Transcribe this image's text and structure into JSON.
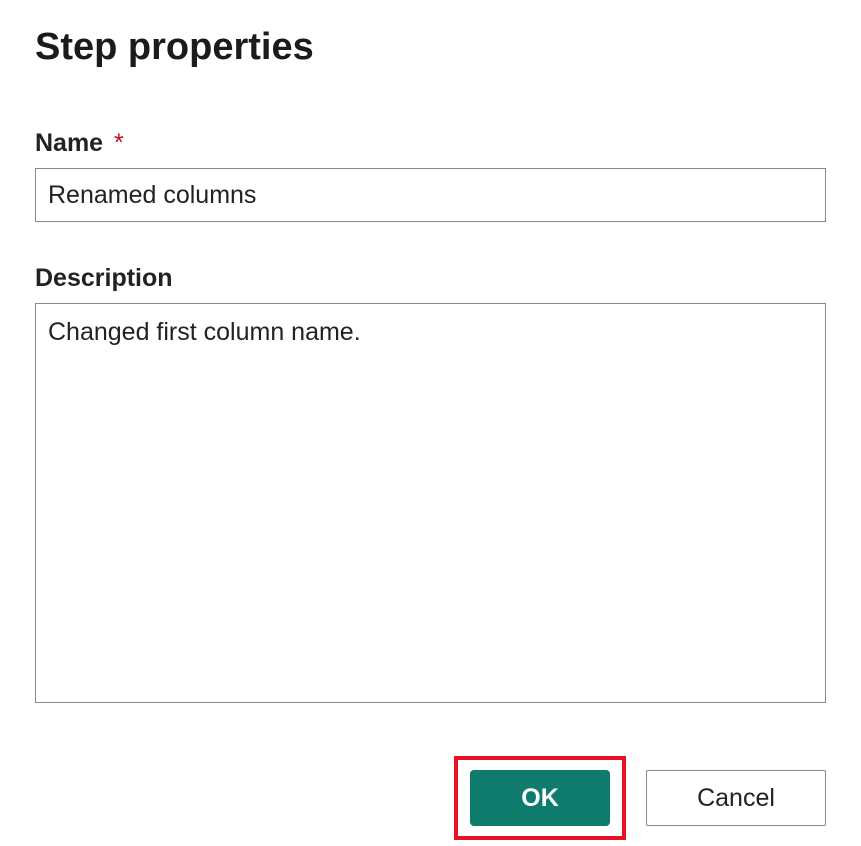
{
  "dialog": {
    "title": "Step properties",
    "name_label": "Name",
    "required_mark": "*",
    "name_value": "Renamed columns",
    "description_label": "Description",
    "description_value": "Changed first column name.",
    "ok_label": "OK",
    "cancel_label": "Cancel"
  },
  "colors": {
    "primary": "#0f7b6c",
    "highlight_border": "#e81123",
    "required": "#c50f1f"
  }
}
